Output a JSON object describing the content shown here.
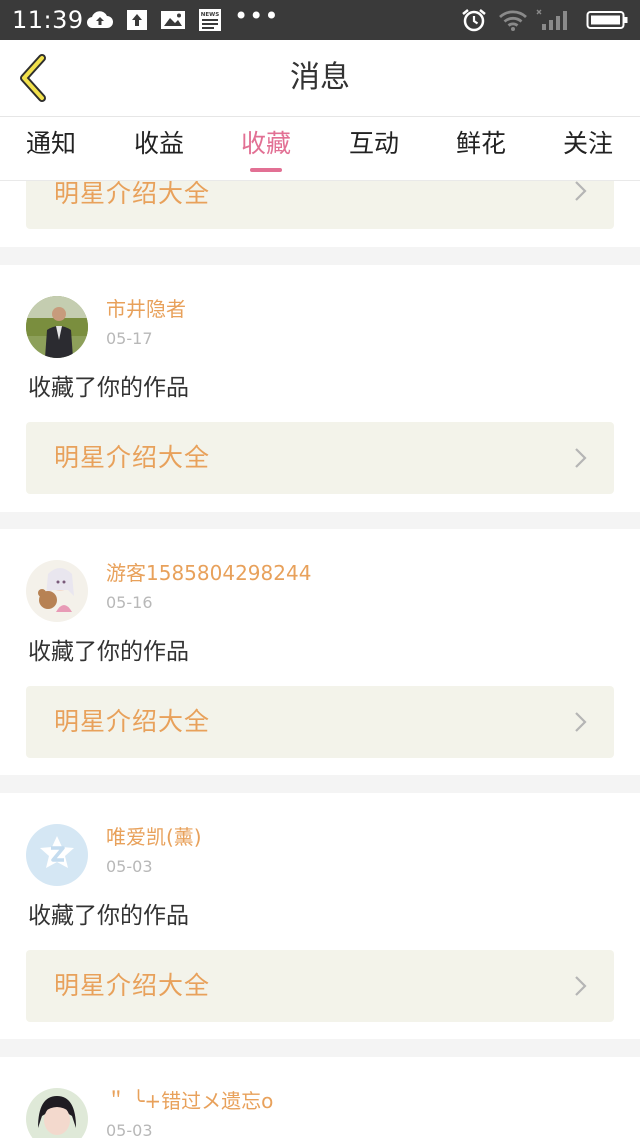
{
  "status_bar": {
    "time": "11:39",
    "left_icons": [
      "cloud-upload-icon",
      "upload-icon",
      "image-icon",
      "news-icon",
      "more-dots-icon"
    ],
    "right_icons": [
      "alarm-icon",
      "wifi-icon",
      "signal-icon",
      "battery-icon"
    ],
    "dots": "•••",
    "news_label": "NEWS"
  },
  "nav": {
    "title": "消息",
    "back_icon": "chevron-left-icon"
  },
  "tabs": [
    {
      "label": "通知"
    },
    {
      "label": "收益"
    },
    {
      "label": "收藏"
    },
    {
      "label": "互动"
    },
    {
      "label": "鲜花"
    },
    {
      "label": "关注"
    }
  ],
  "active_tab": "收藏",
  "colors": {
    "accent_pink": "#e27094",
    "work_title_orange": "#e8a15b",
    "work_box_bg": "#f3f3ea"
  },
  "partial_top_card": {
    "work_title": "明星介绍大全"
  },
  "messages": [
    {
      "username": "市井隐者",
      "date": "05-17",
      "action": "收藏了你的作品",
      "work_title": "明星介绍大全"
    },
    {
      "username": "游客1585804298244",
      "date": "05-16",
      "action": "收藏了你的作品",
      "work_title": "明星介绍大全"
    },
    {
      "username": "唯爱凯(薰)",
      "date": "05-03",
      "action": "收藏了你的作品",
      "work_title": "明星介绍大全"
    },
    {
      "username": "＂ ╰+错过メ遗忘o",
      "date": "05-03"
    }
  ]
}
